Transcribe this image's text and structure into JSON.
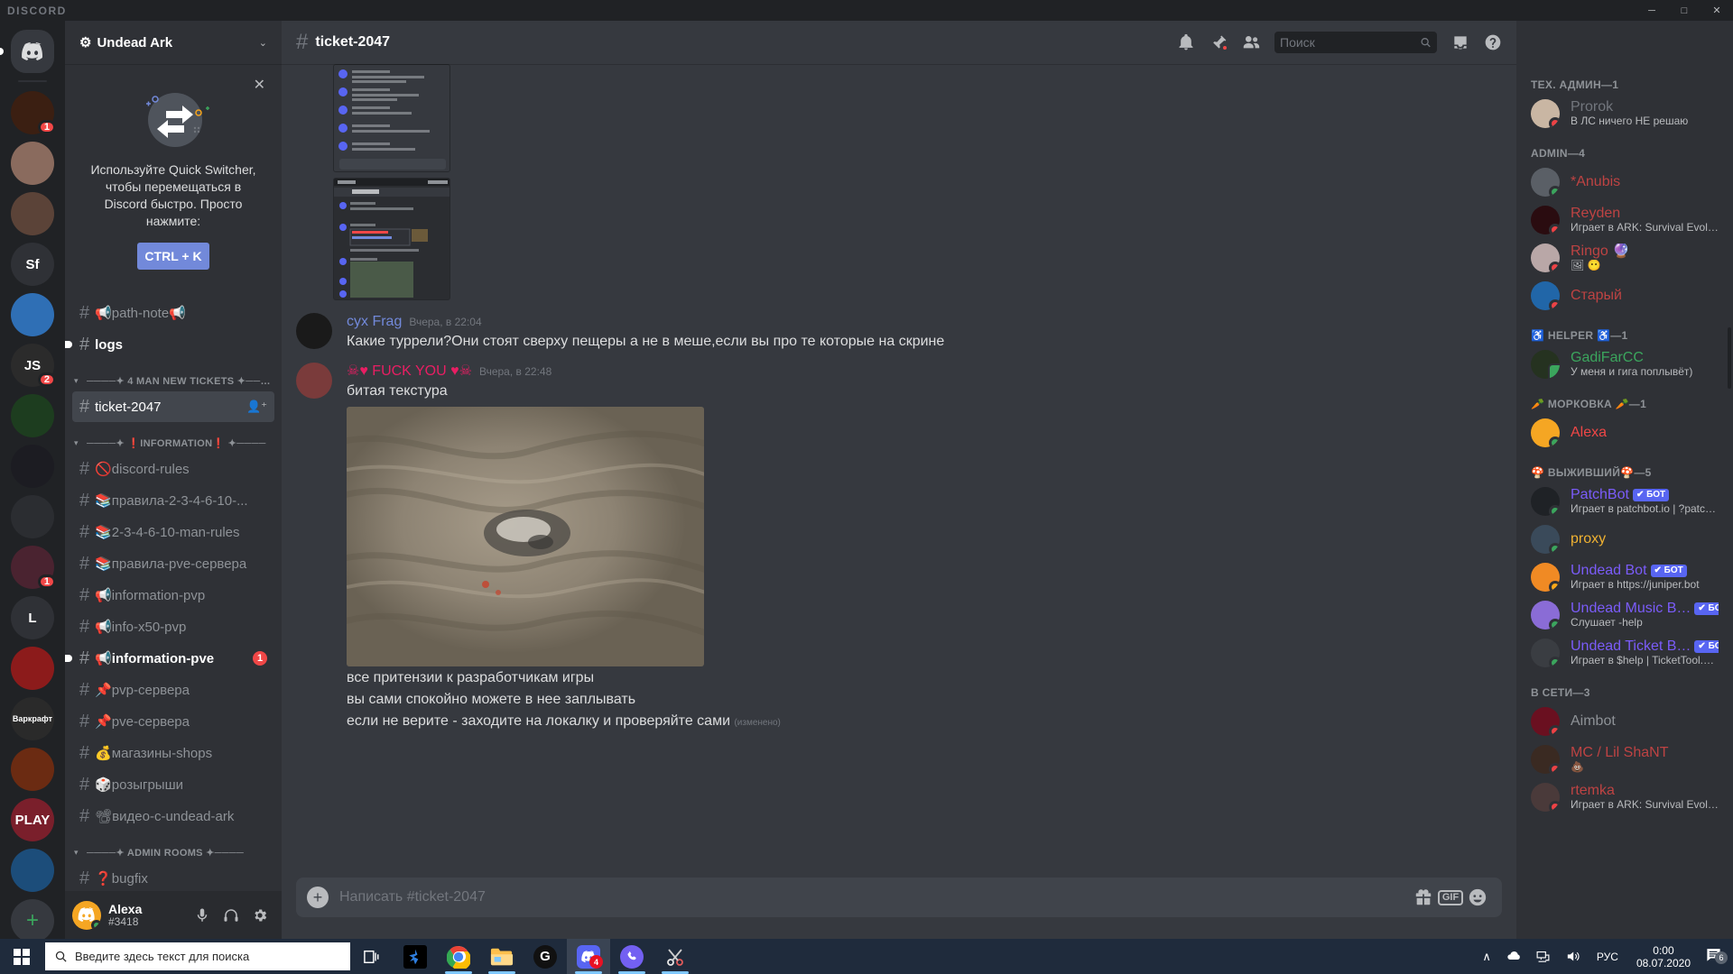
{
  "window": {
    "app_logo_text": "DISCORD",
    "minimize": "─",
    "maximize": "□",
    "close": "✕"
  },
  "guild_rail": {
    "home_label": "Discord Home",
    "servers": [
      {
        "name": "server-fireworks",
        "badge": "1",
        "color": "#3b1f12"
      },
      {
        "name": "server-anime-girl",
        "badge": "",
        "color": "#8a6b5e"
      },
      {
        "name": "server-portrait",
        "badge": "",
        "color": "#5b4338"
      },
      {
        "name": "server-sf",
        "badge": "",
        "color": "#2f3136",
        "text": "Sf"
      },
      {
        "name": "server-pokeball",
        "badge": "",
        "color": "#2f6fb5"
      },
      {
        "name": "server-js",
        "badge": "2",
        "color": "#2b2b2b",
        "text": "JS"
      },
      {
        "name": "server-frog",
        "badge": "",
        "color": "#1d3d1f"
      },
      {
        "name": "server-dark-circle",
        "badge": "",
        "color": "#1c1c22"
      },
      {
        "name": "server-diamond",
        "badge": "",
        "color": "#2b2d31"
      },
      {
        "name": "server-joker",
        "badge": "1",
        "color": "#4a2330"
      },
      {
        "name": "server-l",
        "badge": "",
        "color": "#2f3136",
        "text": "L"
      },
      {
        "name": "server-red",
        "badge": "",
        "color": "#8c1b1b"
      },
      {
        "name": "server-warcraft",
        "badge": "",
        "color": "#2a2a2a",
        "text": "Варкрафт"
      },
      {
        "name": "server-fire",
        "badge": "",
        "color": "#6b2b12"
      },
      {
        "name": "server-play",
        "badge": "",
        "color": "#7a1f2b",
        "text": "PLAY"
      },
      {
        "name": "server-blue-swirl",
        "badge": "",
        "color": "#1c4d7a"
      }
    ],
    "add_server": "+"
  },
  "sidebar": {
    "server_name": "Undead Ark",
    "server_name_emoji": "⚙",
    "chevron": "⌄",
    "quick_switcher": {
      "close": "✕",
      "text": "Используйте Quick Switcher, чтобы перемещаться в Discord быстро. Просто нажмите:",
      "key_label": "CTRL + K"
    },
    "items": [
      {
        "kind": "channel",
        "emoji": "📢",
        "label": "path-note📢",
        "state": "normal",
        "badge": ""
      },
      {
        "kind": "channel",
        "emoji": "",
        "label": "logs",
        "state": "unread",
        "badge": ""
      },
      {
        "kind": "category",
        "label": "────✦ 4 MAN NEW TICKETS ✦────"
      },
      {
        "kind": "channel",
        "emoji": "",
        "label": "ticket-2047",
        "state": "active",
        "badge": "",
        "locked": true,
        "adduser": true
      },
      {
        "kind": "category",
        "label": "────✦ ❗INFORMATION❗ ✦────"
      },
      {
        "kind": "channel",
        "emoji": "🚫",
        "label": "discord-rules",
        "state": "normal",
        "badge": ""
      },
      {
        "kind": "channel",
        "emoji": "📚",
        "label": "правила-2-3-4-6-10-...",
        "state": "normal",
        "badge": ""
      },
      {
        "kind": "channel",
        "emoji": "📚",
        "label": "2-3-4-6-10-man-rules",
        "state": "normal",
        "badge": ""
      },
      {
        "kind": "channel",
        "emoji": "📚",
        "label": "правила-pve-сервера",
        "state": "normal",
        "badge": ""
      },
      {
        "kind": "channel",
        "emoji": "📢",
        "label": "information-pvp",
        "state": "normal",
        "badge": ""
      },
      {
        "kind": "channel",
        "emoji": "📢",
        "label": "info-x50-pvp",
        "state": "normal",
        "badge": ""
      },
      {
        "kind": "channel",
        "emoji": "📢",
        "label": "information-pve",
        "state": "unread",
        "badge": "1"
      },
      {
        "kind": "channel",
        "emoji": "📌",
        "label": "pvp-сервера",
        "state": "normal",
        "badge": ""
      },
      {
        "kind": "channel",
        "emoji": "📌",
        "label": "pve-сервера",
        "state": "normal",
        "badge": ""
      },
      {
        "kind": "channel",
        "emoji": "💰",
        "label": "магазины-shops",
        "state": "normal",
        "badge": ""
      },
      {
        "kind": "channel",
        "emoji": "🎲",
        "label": "розыгрыши",
        "state": "normal",
        "badge": ""
      },
      {
        "kind": "channel",
        "emoji": "📽",
        "label": "видео-с-undead-ark",
        "state": "normal",
        "badge": ""
      },
      {
        "kind": "category",
        "label": "────✦ ADMIN ROOMS ✦────"
      },
      {
        "kind": "channel",
        "emoji": "❓",
        "label": "bugfix",
        "state": "normal",
        "badge": ""
      }
    ],
    "user_panel": {
      "username": "Alexa",
      "tag": "#3418",
      "mic_icon": "mic-icon",
      "headset_icon": "headset-icon",
      "settings_icon": "gear-icon"
    }
  },
  "header": {
    "hash": "#",
    "channel_title": "ticket-2047",
    "icons": [
      "bell-icon",
      "pin-icon",
      "members-icon",
      "inbox-icon",
      "help-icon"
    ],
    "search_placeholder": "Поиск",
    "search_value": ""
  },
  "messages": [
    {
      "author": "cyx Frag",
      "author_color": "#7289da",
      "timestamp": "Вчера, в 22:04",
      "text": "Какие туррели?Они стоят сверху пещеры а не в меше,если вы про те которые на скрине",
      "has_image": false
    },
    {
      "author": "☠♥ FUCK YOU ♥☠",
      "author_color": "#e91e63",
      "timestamp": "Вчера, в 22:48",
      "text": "битая текстура",
      "has_image": true,
      "extra_lines": [
        "все притензии к разработчикам игры",
        "вы сами спокойно можете в нее заплывать",
        "если не верите - заходите на локалку и проверяйте сами"
      ],
      "edited_label": "(изменено)"
    }
  ],
  "composer": {
    "plus": "+",
    "placeholder": "Написать #ticket-2047",
    "value": "",
    "gift_icon": "gift-icon",
    "gif_label": "GIF",
    "emoji_icon": "emoji-icon"
  },
  "members": {
    "groups": [
      {
        "title": "ТЕХ. АДМИН—1",
        "users": [
          {
            "name": "Prorok",
            "color": "#72767d",
            "status": "dnd",
            "activity": "В ЛС ничего НЕ решаю",
            "bot": false,
            "avatar": "#c9b6a3"
          }
        ]
      },
      {
        "title": "ADMIN—4",
        "users": [
          {
            "name": "*Anubis",
            "color": "#be4343",
            "status": "online",
            "activity": "",
            "bot": false,
            "avatar": "#5a5f66"
          },
          {
            "name": "Reyden",
            "color": "#be4343",
            "status": "dnd",
            "activity": "Играет в ARK: Survival Evolved",
            "bot": false,
            "avatar": "#2a0c10"
          },
          {
            "name": "Ringo 🔮",
            "color": "#be4343",
            "status": "dnd",
            "activity": "🖼 😶",
            "bot": false,
            "avatar": "#b9a7a7"
          },
          {
            "name": "Старый",
            "color": "#be4343",
            "status": "dnd",
            "activity": "",
            "bot": false,
            "avatar": "#2166a8"
          }
        ]
      },
      {
        "title": "♿ HELPER ♿—1",
        "users": [
          {
            "name": "GadiFarCC",
            "color": "#3ba55d",
            "status": "mobile",
            "activity": "У меня и гига поплывёт)",
            "bot": false,
            "avatar": "#253220"
          }
        ]
      },
      {
        "title": "🥕 МОРКОВКА 🥕—1",
        "users": [
          {
            "name": "Alexa",
            "color": "#f04747",
            "status": "online",
            "activity": "",
            "bot": false,
            "avatar": "#f5a623"
          }
        ]
      },
      {
        "title": "🍄 ВЫЖИВШИЙ🍄—5",
        "users": [
          {
            "name": "PatchBot",
            "color": "#7b5cfa",
            "status": "online",
            "activity": "Играет в patchbot.io | ?patch...",
            "bot": true,
            "bot_label": "БОТ",
            "avatar": "#1f2226"
          },
          {
            "name": "proxy",
            "color": "#f0b232",
            "status": "online",
            "activity": "",
            "bot": false,
            "avatar": "#3a4a5a"
          },
          {
            "name": "Undead Bot",
            "color": "#7b5cfa",
            "status": "idle",
            "activity": "Играет в https://juniper.bot",
            "bot": true,
            "bot_label": "БОТ",
            "avatar": "#f08a24"
          },
          {
            "name": "Undead Music B…",
            "color": "#7b5cfa",
            "status": "online",
            "activity": "Слушает -help",
            "bot": true,
            "bot_label": "БОТ",
            "avatar": "#8a6cd6"
          },
          {
            "name": "Undead Ticket B…",
            "color": "#7b5cfa",
            "status": "online",
            "activity": "Играет в $help | TicketTool.xy...",
            "bot": true,
            "bot_label": "БОТ",
            "avatar": "#3a3d42"
          }
        ]
      },
      {
        "title": "В СЕТИ—3",
        "users": [
          {
            "name": "Aimbot",
            "color": "#8e9297",
            "status": "dnd",
            "activity": "",
            "bot": false,
            "avatar": "#6a1020"
          },
          {
            "name": "MC / Lil ShaNT",
            "color": "#be4343",
            "status": "dnd",
            "activity": "💩",
            "bot": false,
            "avatar": "#3a2a22"
          },
          {
            "name": "rtemka",
            "color": "#be4343",
            "status": "dnd",
            "activity": "Играет в ARK: Survival Evolved",
            "bot": false,
            "avatar": "#4a3a3a"
          }
        ]
      }
    ]
  },
  "taskbar": {
    "start_icon": "windows-icon",
    "search_placeholder": "Введите здесь текст для поиска",
    "items": [
      {
        "name": "task-view-icon",
        "badge": "",
        "active": false,
        "running": false
      },
      {
        "name": "blue-app-icon",
        "badge": "",
        "active": false,
        "running": false
      },
      {
        "name": "chrome-icon",
        "badge": "",
        "active": false,
        "running": true
      },
      {
        "name": "file-explorer-icon",
        "badge": "",
        "active": false,
        "running": true
      },
      {
        "name": "logitech-icon",
        "badge": "",
        "active": false,
        "running": false
      },
      {
        "name": "discord-icon",
        "badge": "4",
        "active": true,
        "running": true
      },
      {
        "name": "viber-icon",
        "badge": "",
        "active": false,
        "running": true
      },
      {
        "name": "snip-icon",
        "badge": "",
        "active": false,
        "running": true
      }
    ],
    "tray": {
      "chevron": "∧",
      "onedrive_icon": "cloud-icon",
      "network_icon": "network-icon",
      "volume_icon": "speaker-icon",
      "language": "РУС",
      "time": "0:00",
      "date": "08.07.2020",
      "action_center_icon": "notification-icon",
      "action_center_count": "6"
    }
  },
  "colors": {
    "accent": "#7289da",
    "danger": "#f04747",
    "online": "#3ba55d",
    "bg_dark": "#202225",
    "bg_sidebar": "#2f3136",
    "bg_main": "#36393f"
  }
}
